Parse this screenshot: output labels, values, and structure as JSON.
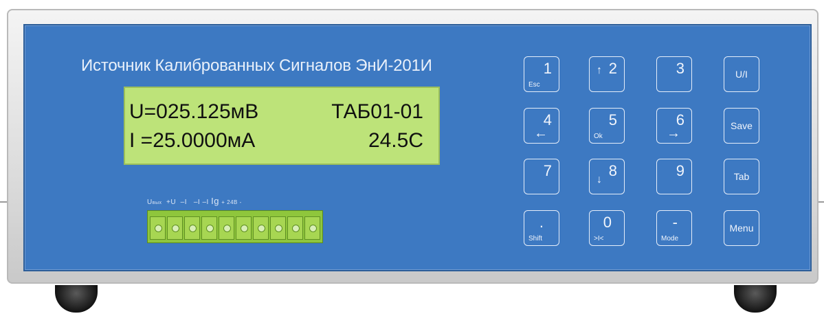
{
  "device": {
    "title": "Источник Калиброванных Сигналов ЭнИ-201И"
  },
  "display": {
    "line1_left": "U=025.125мВ",
    "line1_right": "ТАБ01-01",
    "line2_left": "I =25.0000мА",
    "line2_right": "24.5C"
  },
  "terminals": {
    "label_u": "U",
    "label_u_sub": "вых",
    "label_plus_u": "+U",
    "label_i1": "–I",
    "label_i2": "–I  –I",
    "label_ig": "Ig",
    "label_24v": "+ 24В -"
  },
  "keypad": {
    "k1": {
      "main": "1",
      "sub": "Esc"
    },
    "k2": {
      "main": "2",
      "arrow": "↑"
    },
    "k3": {
      "main": "3"
    },
    "k_ui": {
      "label": "U/I"
    },
    "k4": {
      "main": "4",
      "arrow": "←"
    },
    "k5": {
      "main": "5",
      "sub": "Ok"
    },
    "k6": {
      "main": "6",
      "arrow": "→"
    },
    "k_save": {
      "label": "Save"
    },
    "k7": {
      "main": "7"
    },
    "k8": {
      "main": "8",
      "arrow": "↓"
    },
    "k9": {
      "main": "9"
    },
    "k_tab": {
      "label": "Tab"
    },
    "k_dot": {
      "main": ".",
      "sub": "Shift"
    },
    "k0": {
      "main": "0",
      "sub": ">I<"
    },
    "k_minus": {
      "main": "-",
      "sub": "Mode"
    },
    "k_menu": {
      "label": "Menu"
    }
  },
  "colors": {
    "panel": "#3d79c2",
    "lcd": "#bde379",
    "terminal": "#8fc63c"
  }
}
